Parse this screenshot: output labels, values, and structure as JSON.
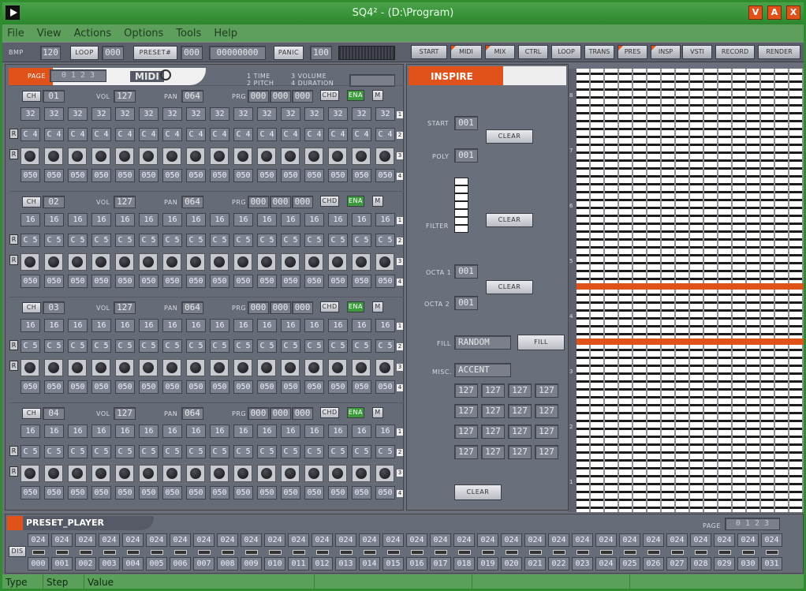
{
  "window": {
    "title": "SQ4² - (D:\\Program)",
    "buttons": [
      "V",
      "A",
      "X"
    ]
  },
  "menu": [
    "File",
    "View",
    "Actions",
    "Options",
    "Tools",
    "Help"
  ],
  "toolbar": {
    "bmp_label": "BMP",
    "bmp": "120",
    "loop": "LOOP",
    "loop_val": "000",
    "preset": "PRESET#",
    "preset_val": "000",
    "preset_code": "00000000",
    "panic": "PANIC",
    "vol": "100",
    "tabs": [
      "START",
      "MIDI",
      "MIX",
      "CTRL",
      "LOOP",
      "TRANS",
      "PRES",
      "INSP",
      "VSTI",
      "RECORD",
      "RENDER"
    ]
  },
  "midi": {
    "page_label": "PAGE",
    "page_digits": "0 1 2 3",
    "title": "MIDI",
    "legend": [
      "1 TIME",
      "2 PITCH",
      "3 VOLUME",
      "4 DURATION"
    ],
    "channels": [
      {
        "ch": "01",
        "vol": "127",
        "pan": "064",
        "prg": [
          "000",
          "000",
          "000"
        ],
        "time": "32",
        "pitch": "C 4",
        "dur": "050"
      },
      {
        "ch": "02",
        "vol": "127",
        "pan": "064",
        "prg": [
          "000",
          "000",
          "000"
        ],
        "time": "16",
        "pitch": "C 5",
        "dur": "050"
      },
      {
        "ch": "03",
        "vol": "127",
        "pan": "064",
        "prg": [
          "000",
          "000",
          "000"
        ],
        "time": "16",
        "pitch": "C 5",
        "dur": "050"
      },
      {
        "ch": "04",
        "vol": "127",
        "pan": "064",
        "prg": [
          "000",
          "000",
          "000"
        ],
        "time": "16",
        "pitch": "C 5",
        "dur": "050"
      }
    ],
    "labels": {
      "ch": "CH",
      "vol": "VOL",
      "pan": "PAN",
      "prg": "PRG",
      "chd": "CHD",
      "ena": "ENA",
      "m": "M",
      "r": "R"
    },
    "rownums": [
      "1",
      "2",
      "3",
      "4"
    ]
  },
  "inspire": {
    "title": "INSPIRE",
    "start_label": "START",
    "start": "001",
    "poly_label": "POLY",
    "poly": "001",
    "filter_label": "FILTER",
    "octa1_label": "OCTA 1",
    "octa1": "001",
    "octa2_label": "OCTA 2",
    "octa2": "001",
    "fill_label": "FILL",
    "fill_mode": "RANDOM",
    "fill_btn": "FILL",
    "misc_label": "MISC.",
    "misc_mode": "ACCENT",
    "clear": "CLEAR",
    "misc_values": [
      "127",
      "127",
      "127",
      "127",
      "127",
      "127",
      "127",
      "127",
      "127",
      "127",
      "127",
      "127",
      "127",
      "127",
      "127",
      "127"
    ]
  },
  "grid": {
    "octaves": [
      "8",
      "7",
      "6",
      "5",
      "4",
      "3",
      "2",
      "1"
    ]
  },
  "preset_player": {
    "title": "PRESET_PLAYER",
    "page_label": "PAGE",
    "page_digits": "0 1 2 3",
    "dis": "DIS",
    "value": "024",
    "slots": [
      "000",
      "001",
      "002",
      "003",
      "004",
      "005",
      "006",
      "007",
      "008",
      "009",
      "010",
      "011",
      "012",
      "013",
      "014",
      "015",
      "016",
      "017",
      "018",
      "019",
      "020",
      "021",
      "022",
      "023",
      "024",
      "025",
      "026",
      "027",
      "028",
      "029",
      "030",
      "031"
    ]
  },
  "status": [
    "Type",
    "Step",
    "Value"
  ]
}
